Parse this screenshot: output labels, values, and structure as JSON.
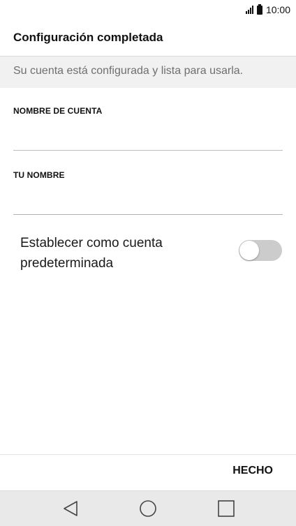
{
  "status_bar": {
    "time": "10:00",
    "signal_icon": "signal-icon",
    "battery_icon": "battery-icon"
  },
  "header": {
    "title": "Configuración completada"
  },
  "subtitle": {
    "text": "Su cuenta está configurada y lista para usarla."
  },
  "fields": [
    {
      "label": "NOMBRE DE CUENTA",
      "value": "",
      "placeholder": ""
    },
    {
      "label": "TU NOMBRE",
      "value": "",
      "placeholder": ""
    }
  ],
  "default_account": {
    "label": "Establecer como cuenta predeterminada",
    "enabled": false
  },
  "footer": {
    "done_label": "HECHO"
  },
  "nav_bar": {
    "back_icon": "back-icon",
    "home_icon": "home-icon",
    "recents_icon": "recents-icon"
  },
  "colors": {
    "accent": "#6fd0c6",
    "toggle_off": "#cccccc",
    "subtitle_bg": "#f1f1f1",
    "nav_bg": "#e9e9e9"
  }
}
